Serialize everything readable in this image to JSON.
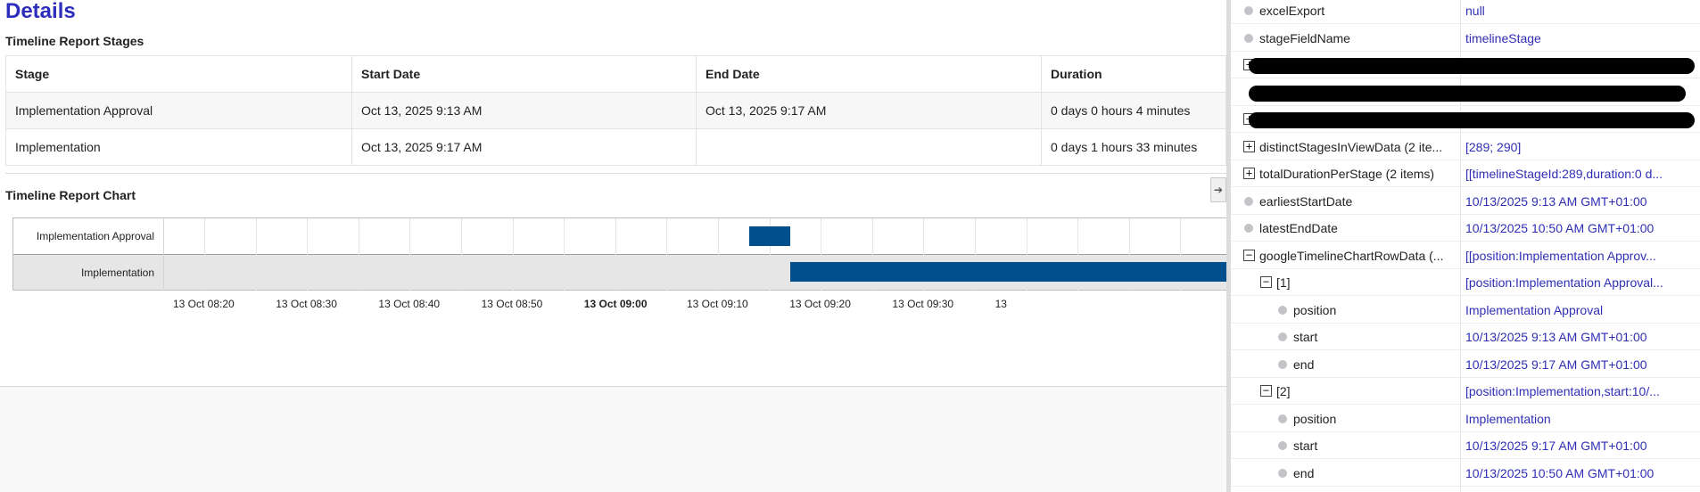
{
  "page": {
    "title": "Details"
  },
  "stages": {
    "title": "Timeline Report Stages",
    "headers": [
      "Stage",
      "Start Date",
      "End Date",
      "Duration"
    ],
    "rows": [
      [
        "Implementation Approval",
        "Oct 13, 2025 9:13 AM",
        "Oct 13, 2025 9:17 AM",
        "0 days 0 hours 4 minutes"
      ],
      [
        "Implementation",
        "Oct 13, 2025 9:17 AM",
        "",
        "0 days 1 hours 33 minutes"
      ]
    ]
  },
  "chart": {
    "title": "Timeline Report Chart",
    "collapse_icon": "arrow-right-icon",
    "collapse_glyph": "➔"
  },
  "chart_data": {
    "type": "timeline",
    "title": "Timeline Report Chart",
    "xlabel": "",
    "ylabel": "",
    "bar_color": "#024f8e",
    "rows": [
      {
        "label": "Implementation Approval",
        "start": "13 Oct 09:13",
        "end": "13 Oct 09:17"
      },
      {
        "label": "Implementation",
        "start": "13 Oct 09:17",
        "end": "13 Oct 10:50"
      }
    ],
    "x_ticks": [
      "13 Oct 08:20",
      "13 Oct 08:30",
      "13 Oct 08:40",
      "13 Oct 08:50",
      "13 Oct 09:00",
      "13 Oct 09:10",
      "13 Oct 09:20",
      "13 Oct 09:30",
      "13"
    ],
    "bold_tick": "13 Oct 09:00"
  },
  "debug": {
    "rows": [
      {
        "name": "excelExport",
        "value": "null",
        "kind": "dot",
        "level": 0
      },
      {
        "name": "stageFieldName",
        "value": "timelineStage",
        "kind": "dot",
        "level": 0
      },
      {
        "name": "",
        "value": "",
        "kind": "plus",
        "level": 0,
        "redacted": true
      },
      {
        "name": "",
        "value": "",
        "kind": "none",
        "level": 0,
        "redacted": true
      },
      {
        "name": "",
        "value": "",
        "kind": "plus",
        "level": 0,
        "redacted": true
      },
      {
        "name": "distinctStagesInViewData (2 ite...",
        "value": "[289; 290]",
        "kind": "plus",
        "level": 0
      },
      {
        "name": "totalDurationPerStage (2 items)",
        "value": "[[timelineStageId:289,duration:0 d...",
        "kind": "plus",
        "level": 0
      },
      {
        "name": "earliestStartDate",
        "value": "10/13/2025 9:13 AM GMT+01:00",
        "kind": "dot",
        "level": 0
      },
      {
        "name": "latestEndDate",
        "value": "10/13/2025 10:50 AM GMT+01:00",
        "kind": "dot",
        "level": 0
      },
      {
        "name": "googleTimelineChartRowData (...",
        "value": "[[position:Implementation Approv...",
        "kind": "minus",
        "level": 0
      },
      {
        "name": "[1]",
        "value": "[position:Implementation Approval...",
        "kind": "minus",
        "level": 1
      },
      {
        "name": "position",
        "value": "Implementation Approval",
        "kind": "dot",
        "level": 2
      },
      {
        "name": "start",
        "value": "10/13/2025 9:13 AM GMT+01:00",
        "kind": "dot",
        "level": 2
      },
      {
        "name": "end",
        "value": "10/13/2025 9:17 AM GMT+01:00",
        "kind": "dot",
        "level": 2
      },
      {
        "name": "[2]",
        "value": "[position:Implementation,start:10/...",
        "kind": "minus",
        "level": 1
      },
      {
        "name": "position",
        "value": "Implementation",
        "kind": "dot",
        "level": 2
      },
      {
        "name": "start",
        "value": "10/13/2025 9:17 AM GMT+01:00",
        "kind": "dot",
        "level": 2
      },
      {
        "name": "end",
        "value": "10/13/2025 10:50 AM GMT+01:00",
        "kind": "dot",
        "level": 2
      }
    ]
  }
}
